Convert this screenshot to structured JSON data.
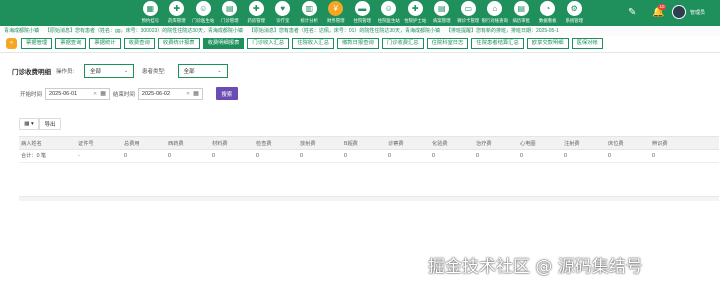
{
  "colors": {
    "primary": "#1f8f5c",
    "highlight": "#f5a623",
    "search_button": "#6a4cb3",
    "badge": "#e64340"
  },
  "nav": [
    {
      "label": "预约挂号",
      "icon": "calendar-icon",
      "glyph": "▦"
    },
    {
      "label": "药库管理",
      "icon": "pill-icon",
      "glyph": "✚"
    },
    {
      "label": "门诊医生站",
      "icon": "doctor-icon",
      "glyph": "☺"
    },
    {
      "label": "门诊管理",
      "icon": "clipboard-icon",
      "glyph": "▤"
    },
    {
      "label": "药房管理",
      "icon": "medicine-icon",
      "glyph": "✚"
    },
    {
      "label": "诊疗室",
      "icon": "stethoscope-icon",
      "glyph": "♥"
    },
    {
      "label": "统计分析",
      "icon": "chart-icon",
      "glyph": "▥"
    },
    {
      "label": "财务管理",
      "icon": "finance-icon",
      "glyph": "¥",
      "highlight": true
    },
    {
      "label": "住院管理",
      "icon": "bed-icon",
      "glyph": "▬"
    },
    {
      "label": "住院医生站",
      "icon": "doctor-icon",
      "glyph": "☺"
    },
    {
      "label": "住院护士站",
      "icon": "nurse-icon",
      "glyph": "✚"
    },
    {
      "label": "病案管理",
      "icon": "folder-icon",
      "glyph": "▤"
    },
    {
      "label": "微诊卡管理",
      "icon": "card-icon",
      "glyph": "▭"
    },
    {
      "label": "银行对账查询",
      "icon": "bank-icon",
      "glyph": "⌂"
    },
    {
      "label": "病历审批",
      "icon": "document-icon",
      "glyph": "▤"
    },
    {
      "label": "数据看板",
      "icon": "dashboard-icon",
      "glyph": "◔"
    },
    {
      "label": "系统管理",
      "icon": "gear-icon",
      "glyph": "⚙"
    }
  ],
  "header": {
    "badge_count": "10",
    "username": "管理员"
  },
  "notice": {
    "items": [
      "青海成都院小镇",
      "【原始消息】您有患者（姓名：gg，床号：300023）的院性住院达30天，青海成都院小镇",
      "【原始消息】您有患者（姓名：达佩，床号：01）的院性住院达30天，青海成都院小镇",
      "【排班提醒】您有新的排班，排班日期：2025-05-1"
    ]
  },
  "tabs": [
    {
      "label": "票据管理",
      "active": false
    },
    {
      "label": "票据查询",
      "active": false
    },
    {
      "label": "票据统计",
      "active": false
    },
    {
      "label": "收费查询",
      "active": false
    },
    {
      "label": "收费统计报表",
      "active": false
    },
    {
      "label": "收费明细报表",
      "active": true
    },
    {
      "label": "门诊收入汇总",
      "active": false
    },
    {
      "label": "住院收入汇总",
      "active": false
    },
    {
      "label": "缴款日报查询",
      "active": false
    },
    {
      "label": "门诊收费汇总",
      "active": false
    },
    {
      "label": "住院科室日志",
      "active": false
    },
    {
      "label": "住院患者结算汇总",
      "active": false
    },
    {
      "label": "欧享交款明细",
      "active": false
    },
    {
      "label": "医保对帐",
      "active": false
    }
  ],
  "filters": {
    "page_title": "门诊收费明细",
    "operator_label": "操作员:",
    "operator_value": "全部",
    "patient_type_label": "患者类型:",
    "patient_type_value": "全部",
    "start_label": "开始时间",
    "start_value": "2025-06-01",
    "end_label": "结束时间",
    "end_value": "2025-06-02",
    "search_label": "搜索"
  },
  "toolbar": {
    "columns_icon": "▦ ▾",
    "export_label": "导出"
  },
  "table": {
    "columns": [
      "病人姓名",
      "证件号",
      "总费用",
      "西药费",
      "材料费",
      "检查费",
      "放射费",
      "B超费",
      "诊察费",
      "化验费",
      "治疗费",
      "心电图",
      "注射费",
      "床位费",
      "辨识费"
    ],
    "rows": [
      [
        "合计：0 笔",
        "-",
        "0",
        "0",
        "0",
        "0",
        "0",
        "0",
        "0",
        "0",
        "0",
        "0",
        "0",
        "0",
        "0"
      ]
    ]
  },
  "watermark": "掘金技术社区 @ 源码集结号"
}
